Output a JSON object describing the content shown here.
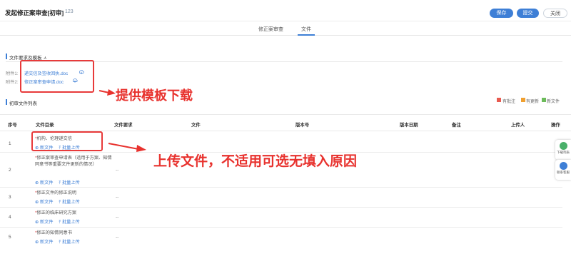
{
  "header": {
    "title": "发起修正案审查[初审]",
    "id_text": "— 123",
    "save_label": "保存",
    "submit_label": "提交",
    "close_label": "关闭"
  },
  "tabs": [
    {
      "label": "修正案审查",
      "active": false
    },
    {
      "label": "文件",
      "active": true
    }
  ],
  "template_section": {
    "title": "文件要求及模板 ㅅ",
    "items": [
      {
        "label": "附件1:",
        "file": "递交信及签收回执.doc"
      },
      {
        "label": "附件2:",
        "file": "修正案审查申请.doc"
      }
    ]
  },
  "file_list": {
    "title": "初审文件列表",
    "legend": [
      {
        "label": "有批注",
        "color": "#e85a4f"
      },
      {
        "label": "有更新",
        "color": "#f0a030"
      },
      {
        "label": "新文件",
        "color": "#6cbb5a"
      }
    ],
    "columns": [
      "序号",
      "文件目录",
      "文件要求",
      "文件",
      "版本号",
      "版本日期",
      "备注",
      "上传人",
      "操作"
    ],
    "new_file_label": "新文件",
    "batch_upload_label": "批量上传",
    "rows": [
      {
        "seq": "1",
        "name": "机构、伦理递交信",
        "req": ""
      },
      {
        "seq": "2",
        "name": "修正案审查申请表（适用于方案、知情同意书等重要文件更新的情况）",
        "req": "--"
      },
      {
        "seq": "3",
        "name": "修正文件的修正说明",
        "req": "--"
      },
      {
        "seq": "4",
        "name": "修正的临床研究方案",
        "req": "--"
      },
      {
        "seq": "5",
        "name": "修正的知情同意书",
        "req": "--"
      }
    ]
  },
  "annotations": {
    "template_note": "提供模板下载",
    "upload_note": "上传文件，不适用可选无填入原因"
  },
  "floating": {
    "download_label": "下载列表",
    "service_label": "联系客服"
  },
  "colors": {
    "primary": "#3e7fd6",
    "annotation_red": "#e8322e"
  }
}
